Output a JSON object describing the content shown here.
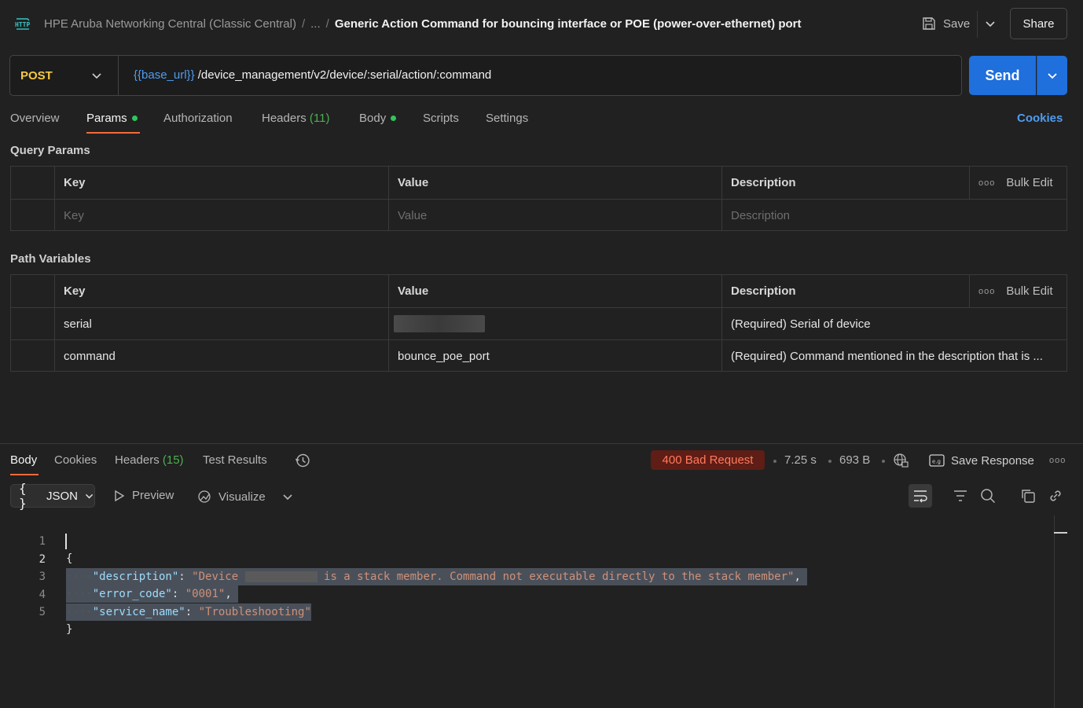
{
  "header": {
    "workspace": "HPE Aruba Networking Central (Classic Central)",
    "ellipsis": "...",
    "sep": "/",
    "title": "Generic Action Command for bouncing interface or POE (power-over-ethernet) port",
    "save_label": "Save",
    "share_label": "Share",
    "icon": "http-icon"
  },
  "request": {
    "method": "POST",
    "url_var": "{{base_url}}",
    "url_path": " /device_management/v2/device/:serial/action/:command",
    "send_label": "Send"
  },
  "tabs": {
    "overview": "Overview",
    "params": "Params",
    "authorization": "Authorization",
    "headers": "Headers",
    "headers_count": "(11)",
    "body": "Body",
    "scripts": "Scripts",
    "settings": "Settings",
    "cookies": "Cookies"
  },
  "query_params": {
    "label": "Query Params",
    "col_key": "Key",
    "col_value": "Value",
    "col_description": "Description",
    "bulk_edit": "Bulk Edit",
    "placeholder_key": "Key",
    "placeholder_value": "Value",
    "placeholder_description": "Description"
  },
  "path_variables": {
    "label": "Path Variables",
    "col_key": "Key",
    "col_value": "Value",
    "col_description": "Description",
    "bulk_edit": "Bulk Edit",
    "rows": [
      {
        "key": "serial",
        "value": "",
        "description": "(Required) Serial of device"
      },
      {
        "key": "command",
        "value": "bounce_poe_port",
        "description": "(Required) Command mentioned in the description that is ..."
      }
    ]
  },
  "response": {
    "tab_body": "Body",
    "tab_cookies": "Cookies",
    "tab_headers": "Headers",
    "tab_headers_count": "(15)",
    "tab_test_results": "Test Results",
    "status": "400 Bad Request",
    "time": "7.25 s",
    "size": "693 B",
    "save_response": "Save Response",
    "format": "JSON",
    "preview": "Preview",
    "visualize": "Visualize",
    "colors": {
      "status_bg": "#5e1d15",
      "status_text": "#ff7b5e",
      "send": "#1f6fdc",
      "method": "#f5c842"
    }
  },
  "code": {
    "line_numbers": [
      "1",
      "2",
      "3",
      "4",
      "5"
    ],
    "open_brace": "{",
    "close_brace": "}",
    "desc_key": "\"description\"",
    "desc_val_pre": "\"Device ",
    "desc_val_post": " is a stack member. Command not executable directly to the stack member\"",
    "err_key": "\"error_code\"",
    "err_val": "\"0001\"",
    "svc_key": "\"service_name\"",
    "svc_val": "\"Troubleshooting\"",
    "colon": ": ",
    "comma": ",",
    "indent": "····"
  }
}
